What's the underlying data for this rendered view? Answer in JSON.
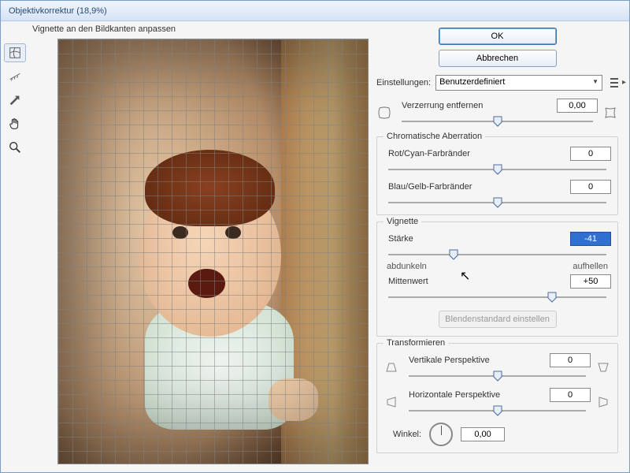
{
  "window": {
    "title": "Objektivkorrektur (18,9%)"
  },
  "preview": {
    "header": "Vignette an den Bildkanten anpassen"
  },
  "buttons": {
    "ok": "OK",
    "cancel": "Abbrechen",
    "blend_default": "Blendenstandard einstellen"
  },
  "settings": {
    "label": "Einstellungen:",
    "value": "Benutzerdefiniert"
  },
  "distortion": {
    "label": "Verzerrung entfernen",
    "value": "0,00",
    "pos": 50
  },
  "groups": {
    "chromatic": {
      "title": "Chromatische Aberration",
      "red": {
        "label": "Rot/Cyan-Farbränder",
        "value": "0",
        "pos": 50
      },
      "blue": {
        "label": "Blau/Gelb-Farbränder",
        "value": "0",
        "pos": 50
      }
    },
    "vignette": {
      "title": "Vignette",
      "strength": {
        "label": "Stärke",
        "value": "-41",
        "pos": 30,
        "left": "abdunkeln",
        "right": "aufhellen"
      },
      "midpoint": {
        "label": "Mittenwert",
        "value": "+50",
        "pos": 75
      }
    },
    "transform": {
      "title": "Transformieren",
      "vpersp": {
        "label": "Vertikale Perspektive",
        "value": "0",
        "pos": 50
      },
      "hpersp": {
        "label": "Horizontale Perspektive",
        "value": "0",
        "pos": 50
      },
      "angle": {
        "label": "Winkel:",
        "value": "0,00"
      }
    }
  }
}
